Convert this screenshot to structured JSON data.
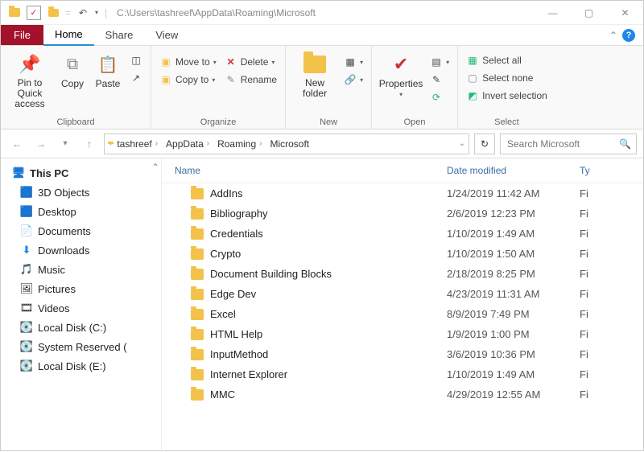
{
  "title_path": "C:\\Users\\tashreef\\AppData\\Roaming\\Microsoft",
  "tabs": {
    "file": "File",
    "home": "Home",
    "share": "Share",
    "view": "View"
  },
  "ribbon": {
    "clipboard": {
      "title": "Clipboard",
      "pin": "Pin to Quick access",
      "copy": "Copy",
      "paste": "Paste"
    },
    "organize": {
      "title": "Organize",
      "moveto": "Move to",
      "copyto": "Copy to",
      "delete": "Delete",
      "rename": "Rename"
    },
    "new": {
      "title": "New",
      "newfolder": "New folder"
    },
    "open": {
      "title": "Open",
      "properties": "Properties"
    },
    "select": {
      "title": "Select",
      "all": "Select all",
      "none": "Select none",
      "invert": "Invert selection"
    }
  },
  "breadcrumbs": [
    "tashreef",
    "AppData",
    "Roaming",
    "Microsoft"
  ],
  "search_placeholder": "Search Microsoft",
  "columns": {
    "name": "Name",
    "date": "Date modified",
    "type": "Ty"
  },
  "sidebar": {
    "header": "This PC",
    "items": [
      {
        "label": "3D Objects",
        "icon": "cube"
      },
      {
        "label": "Desktop",
        "icon": "desktop"
      },
      {
        "label": "Documents",
        "icon": "doc"
      },
      {
        "label": "Downloads",
        "icon": "down"
      },
      {
        "label": "Music",
        "icon": "music"
      },
      {
        "label": "Pictures",
        "icon": "pic"
      },
      {
        "label": "Videos",
        "icon": "vid"
      },
      {
        "label": "Local Disk (C:)",
        "icon": "disk"
      },
      {
        "label": "System Reserved (",
        "icon": "disk"
      },
      {
        "label": "Local Disk (E:)",
        "icon": "disk"
      }
    ]
  },
  "files": [
    {
      "name": "AddIns",
      "date": "1/24/2019 11:42 AM",
      "type": "Fi"
    },
    {
      "name": "Bibliography",
      "date": "2/6/2019 12:23 PM",
      "type": "Fi"
    },
    {
      "name": "Credentials",
      "date": "1/10/2019 1:49 AM",
      "type": "Fi"
    },
    {
      "name": "Crypto",
      "date": "1/10/2019 1:50 AM",
      "type": "Fi"
    },
    {
      "name": "Document Building Blocks",
      "date": "2/18/2019 8:25 PM",
      "type": "Fi"
    },
    {
      "name": "Edge Dev",
      "date": "4/23/2019 11:31 AM",
      "type": "Fi"
    },
    {
      "name": "Excel",
      "date": "8/9/2019 7:49 PM",
      "type": "Fi"
    },
    {
      "name": "HTML Help",
      "date": "1/9/2019 1:00 PM",
      "type": "Fi"
    },
    {
      "name": "InputMethod",
      "date": "3/6/2019 10:36 PM",
      "type": "Fi"
    },
    {
      "name": "Internet Explorer",
      "date": "1/10/2019 1:49 AM",
      "type": "Fi"
    },
    {
      "name": "MMC",
      "date": "4/29/2019 12:55 AM",
      "type": "Fi"
    }
  ]
}
